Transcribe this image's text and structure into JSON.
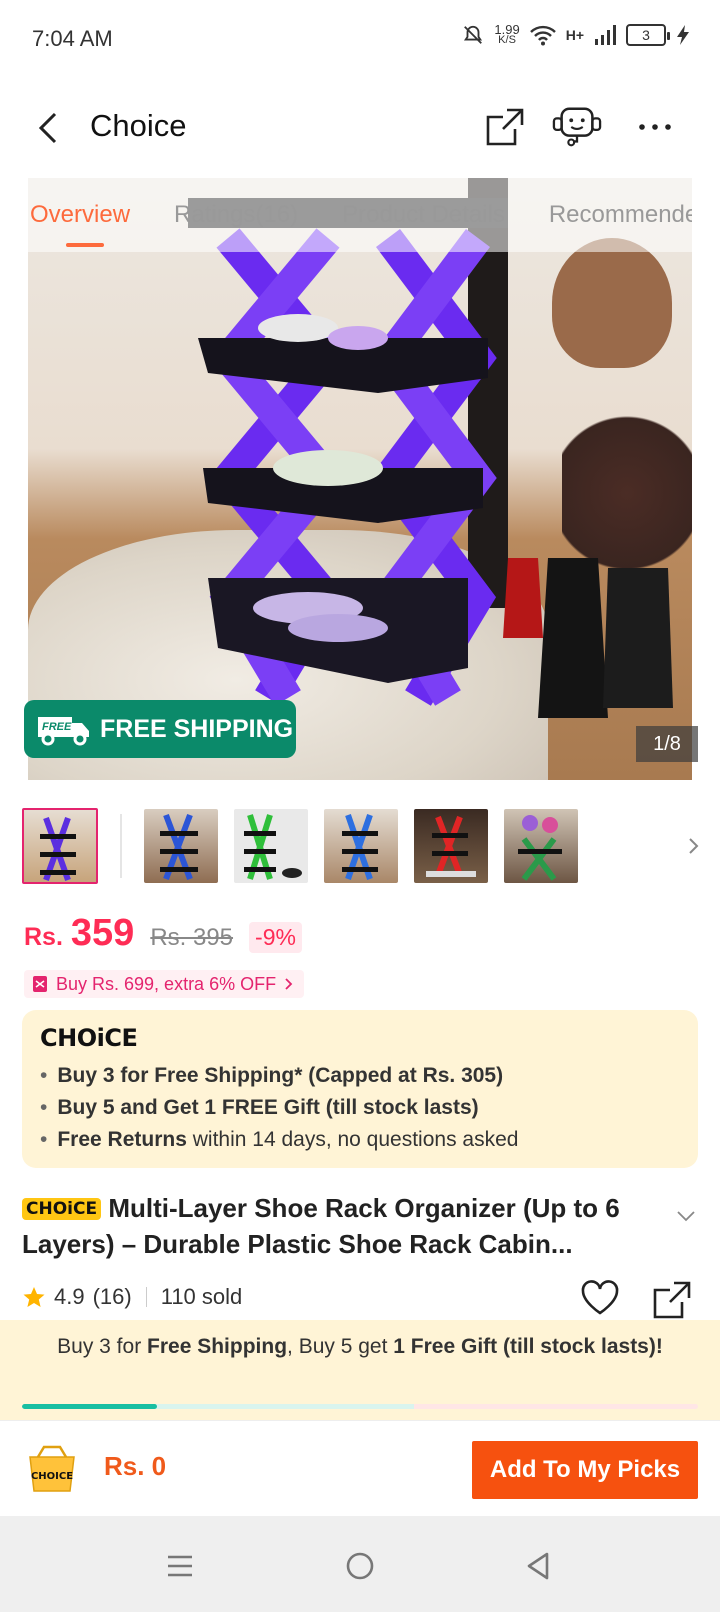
{
  "status_bar": {
    "time": "7:04 AM",
    "net_speed_value": "1.99",
    "net_speed_unit": "K/S",
    "network_type": "H+",
    "battery": "3"
  },
  "header": {
    "title": "Choice"
  },
  "gallery": {
    "tabs": [
      "Overview",
      "Ratings(16)",
      "Product Details",
      "Recommended"
    ],
    "active_tab": "Overview",
    "badge_label": "FREE SHIPPING",
    "badge_icon_text": "FREE",
    "counter": "1/8"
  },
  "thumbnails": {
    "count_shown": 6,
    "colors": [
      "#5b2fe0",
      "#2b55d6",
      "#2fbf3a",
      "#2d6fe0",
      "#e02525",
      "#2a9a4a"
    ]
  },
  "price": {
    "currency": "Rs.",
    "current": "359",
    "original": "Rs. 395",
    "discount": "-9%"
  },
  "coupon": {
    "text": "Buy Rs. 699, extra 6% OFF"
  },
  "choice_box": {
    "logo": "CHOiCE",
    "items": [
      {
        "bold": "Buy 3 for  Free Shipping* (Capped at Rs. 305)",
        "rest": ""
      },
      {
        "bold": "Buy 5 and Get 1 FREE Gift (till stock lasts)",
        "rest": ""
      },
      {
        "bold": "Free Returns",
        "rest": " within 14 days, no questions asked"
      }
    ]
  },
  "product": {
    "badge": "CHOiCE",
    "title": "Multi-Layer Shoe Rack Organizer (Up to 6 Layers) – Durable Plastic Shoe Rack Cabin...",
    "rating": "4.9",
    "reviews": "(16)",
    "sold": "110 sold"
  },
  "promo": {
    "part1": "Buy 3 for ",
    "part2": "Free Shipping",
    "part3": ", Buy 5 get ",
    "part4": "1 Free Gift (till stock lasts)!",
    "progress_fraction": 0.2
  },
  "action_bar": {
    "cart_label": "CHOICE",
    "total": "Rs. 0",
    "button": "Add To My Picks"
  },
  "colors": {
    "accent": "#f6510f",
    "price": "#fe2c55",
    "choice_bg": "#fff4d6",
    "shipping_green": "#0b8a6a"
  }
}
